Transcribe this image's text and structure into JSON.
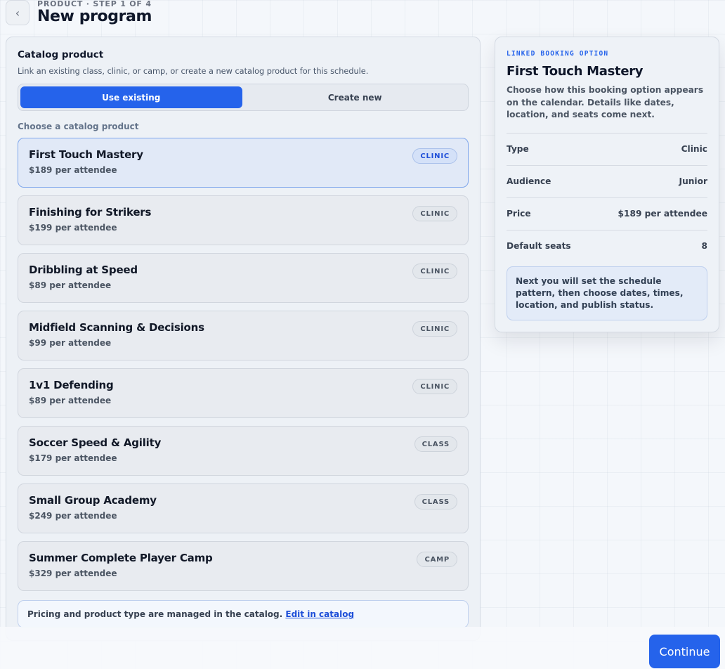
{
  "header": {
    "back_icon": "chevron-left-icon",
    "back_glyph": "‹",
    "eyebrow": "PRODUCT · STEP 1 OF 4",
    "title": "New program"
  },
  "catalog": {
    "title": "Catalog product",
    "subtitle": "Link an existing class, clinic, or camp, or create a new catalog product for this schedule.",
    "tabs": [
      {
        "label": "Use existing",
        "active": true
      },
      {
        "label": "Create new",
        "active": false
      }
    ],
    "choose_label": "Choose a catalog product",
    "products": [
      {
        "name": "First Touch Mastery",
        "price": "$189 per attendee",
        "type": "CLINIC",
        "selected": true
      },
      {
        "name": "Finishing for Strikers",
        "price": "$199 per attendee",
        "type": "CLINIC",
        "selected": false
      },
      {
        "name": "Dribbling at Speed",
        "price": "$89 per attendee",
        "type": "CLINIC",
        "selected": false
      },
      {
        "name": "Midfield Scanning & Decisions",
        "price": "$99 per attendee",
        "type": "CLINIC",
        "selected": false
      },
      {
        "name": "1v1 Defending",
        "price": "$89 per attendee",
        "type": "CLINIC",
        "selected": false
      },
      {
        "name": "Soccer Speed & Agility",
        "price": "$179 per attendee",
        "type": "CLASS",
        "selected": false
      },
      {
        "name": "Small Group Academy",
        "price": "$249 per attendee",
        "type": "CLASS",
        "selected": false
      },
      {
        "name": "Summer Complete Player Camp",
        "price": "$329 per attendee",
        "type": "CAMP",
        "selected": false
      }
    ],
    "note_text": "Pricing and product type are managed in the catalog.",
    "note_link": "Edit in catalog"
  },
  "summary": {
    "eyebrow": "LINKED BOOKING OPTION",
    "title": "First Touch Mastery",
    "description": "Choose how this booking option appears on the calendar. Details like dates, location, and seats come next.",
    "rows": [
      {
        "label": "Type",
        "value": "Clinic"
      },
      {
        "label": "Audience",
        "value": "Junior"
      },
      {
        "label": "Price",
        "value": "$189 per attendee"
      },
      {
        "label": "Default seats",
        "value": "8"
      }
    ],
    "info": "Next you will set the schedule pattern, then choose dates, times, location, and publish status."
  },
  "footer": {
    "continue_label": "Continue"
  },
  "colors": {
    "accent": "#2563eb",
    "selected_bg": "#e1e9f7"
  }
}
